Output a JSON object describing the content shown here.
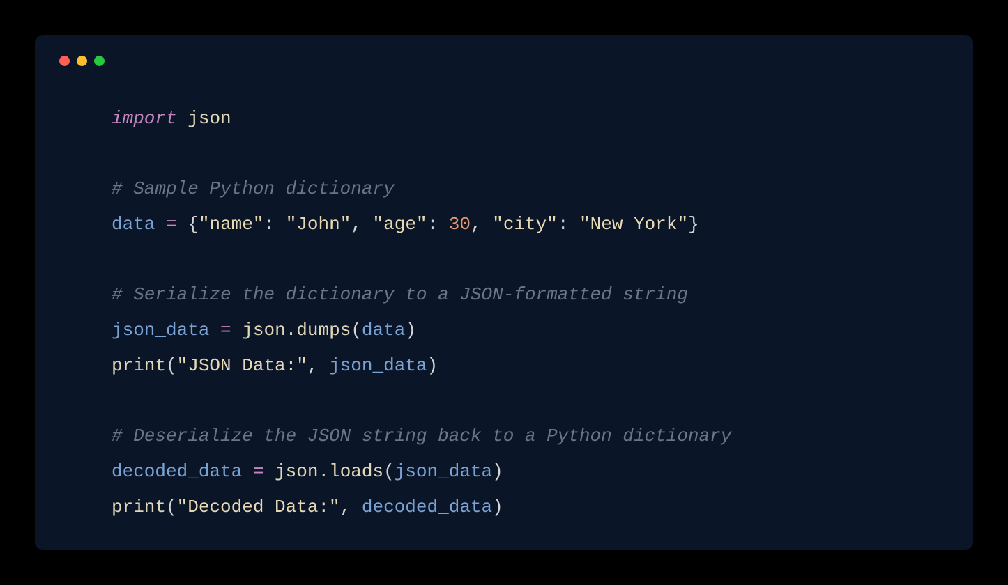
{
  "colors": {
    "bg_outer": "#000000",
    "bg_window": "#0a1628",
    "traffic_red": "#ff5f56",
    "traffic_yellow": "#ffbd2e",
    "traffic_green": "#27c93f",
    "keyword": "#c586c0",
    "comment": "#6b7489",
    "variable": "#7aa2d4",
    "string": "#e8d9b5",
    "number": "#e8956b",
    "function": "#e0d6b8",
    "default": "#d4d4d4"
  },
  "code": {
    "line1": {
      "import_kw": "import",
      "sp1": " ",
      "module": "json"
    },
    "line3": {
      "comment": "# Sample Python dictionary"
    },
    "line4": {
      "var": "data",
      "sp1": " ",
      "op": "=",
      "sp2": " ",
      "lbrace": "{",
      "k1": "\"name\"",
      "colon1": ":",
      "sp3": " ",
      "v1": "\"John\"",
      "comma1": ",",
      "sp4": " ",
      "k2": "\"age\"",
      "colon2": ":",
      "sp5": " ",
      "v2": "30",
      "comma2": ",",
      "sp6": " ",
      "k3": "\"city\"",
      "colon3": ":",
      "sp7": " ",
      "v3": "\"New York\"",
      "rbrace": "}"
    },
    "line6": {
      "comment": "# Serialize the dictionary to a JSON-formatted string"
    },
    "line7": {
      "var": "json_data",
      "sp1": " ",
      "op": "=",
      "sp2": " ",
      "obj": "json",
      "dot": ".",
      "fn": "dumps",
      "lparen": "(",
      "arg": "data",
      "rparen": ")"
    },
    "line8": {
      "fn": "print",
      "lparen": "(",
      "str": "\"JSON Data:\"",
      "comma": ",",
      "sp": " ",
      "arg": "json_data",
      "rparen": ")"
    },
    "line10": {
      "comment": "# Deserialize the JSON string back to a Python dictionary"
    },
    "line11": {
      "var": "decoded_data",
      "sp1": " ",
      "op": "=",
      "sp2": " ",
      "obj": "json",
      "dot": ".",
      "fn": "loads",
      "lparen": "(",
      "arg": "json_data",
      "rparen": ")"
    },
    "line12": {
      "fn": "print",
      "lparen": "(",
      "str": "\"Decoded Data:\"",
      "comma": ",",
      "sp": " ",
      "arg": "decoded_data",
      "rparen": ")"
    }
  }
}
